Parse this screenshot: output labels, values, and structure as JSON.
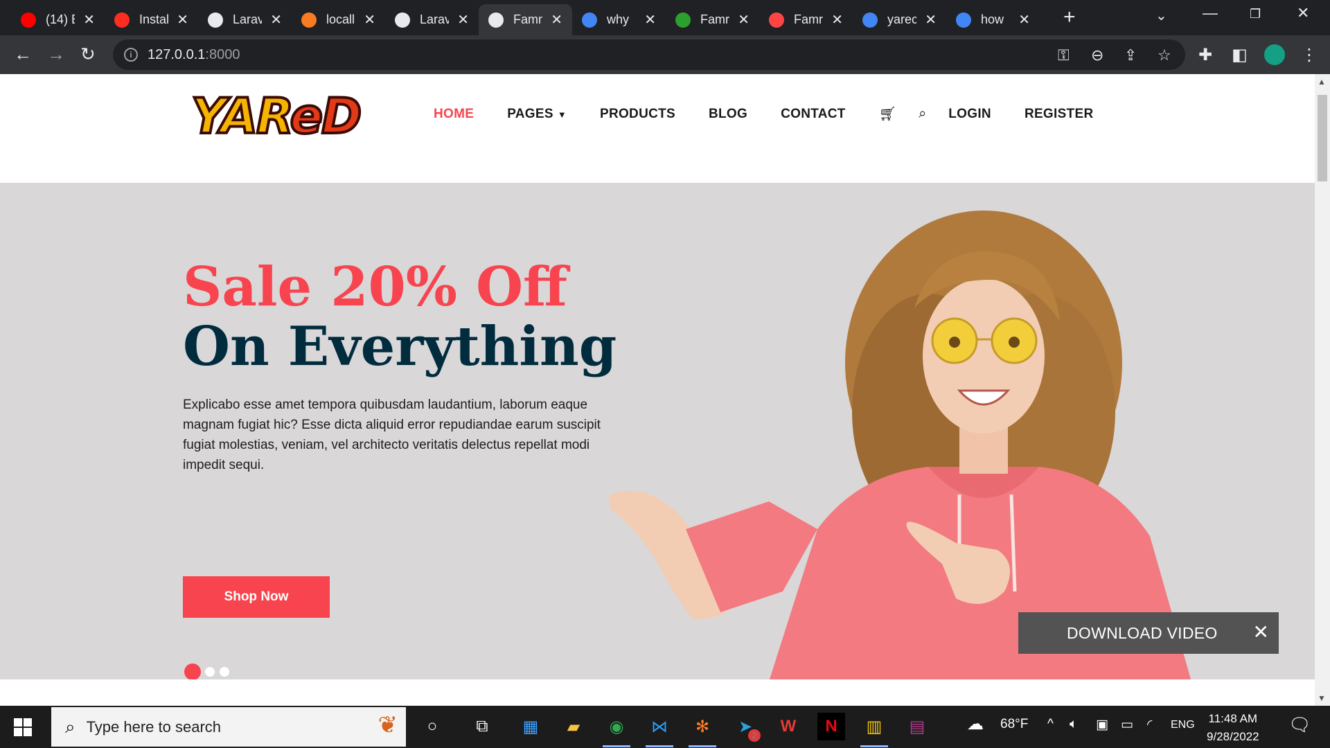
{
  "browser": {
    "tabs": [
      {
        "title": "(14) E",
        "icon": "youtube-icon",
        "color": "#ff0000"
      },
      {
        "title": "Instal",
        "icon": "laravel-icon",
        "color": "#ff2d20"
      },
      {
        "title": "Larav",
        "icon": "globe-icon",
        "color": "#e8eaed"
      },
      {
        "title": "locall",
        "icon": "xampp-icon",
        "color": "#fb7a24"
      },
      {
        "title": "Larav",
        "icon": "globe-icon",
        "color": "#e8eaed"
      },
      {
        "title": "Famm",
        "icon": "globe-icon",
        "color": "#e8eaed"
      },
      {
        "title": "why",
        "icon": "google-icon",
        "color": "#4285f4"
      },
      {
        "title": "Famr",
        "icon": "leaf-icon",
        "color": "#2ca02c"
      },
      {
        "title": "Famr",
        "icon": "mask-icon",
        "color": "#ff4444"
      },
      {
        "title": "yarec",
        "icon": "google-icon",
        "color": "#4285f4"
      },
      {
        "title": "how",
        "icon": "google-icon",
        "color": "#4285f4"
      }
    ],
    "active_tab_index": 5,
    "url_host": "127.0.0.1",
    "url_port": ":8000"
  },
  "site": {
    "logo_text_a": "YAR",
    "logo_text_b": "eD",
    "nav": {
      "home": "HOME",
      "pages": "PAGES",
      "products": "PRODUCTS",
      "blog": "BLOG",
      "contact": "CONTACT",
      "login": "LOGIN",
      "register": "REGISTER"
    },
    "hero": {
      "headline_1": "Sale 20% Off",
      "headline_2": "On Everything",
      "lead": "Explicabo esse amet tempora quibusdam laudantium, laborum eaque magnam fugiat hic? Esse dicta aliquid error repudiandae earum suscipit fugiat molestias, veniam, vel architecto veritatis delectus repellat modi impedit sequi.",
      "cta": "Shop Now",
      "slides": 3,
      "active_slide": 1
    },
    "download_video": "DOWNLOAD VIDEO"
  },
  "colors": {
    "accent": "#f7444e",
    "navy": "#002c3e",
    "hero_bg": "#d9d7d8"
  },
  "taskbar": {
    "search_placeholder": "Type here to search",
    "weather": "68°F",
    "language": "ENG",
    "time": "11:48 AM",
    "date": "9/28/2022",
    "telegram_badge": "2"
  }
}
